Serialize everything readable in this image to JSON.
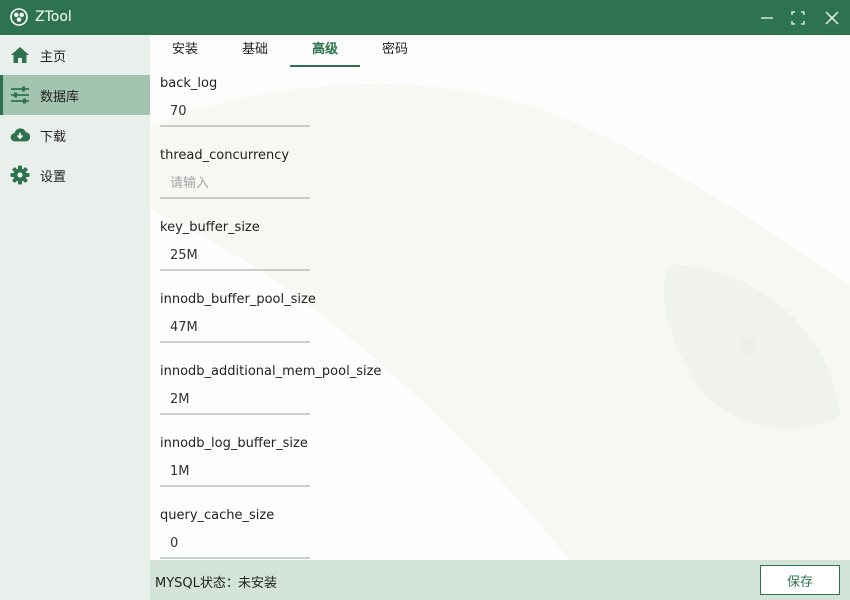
{
  "window": {
    "title": "ZTool",
    "logo_icon": "ztool-logo-icon",
    "controls": [
      "minimize-icon",
      "maximize-icon",
      "close-icon"
    ]
  },
  "sidebar": {
    "items": [
      {
        "label": "主页",
        "icon": "home-icon"
      },
      {
        "label": "数据库",
        "icon": "sliders-icon",
        "active": true
      },
      {
        "label": "下载",
        "icon": "cloud-download-icon"
      },
      {
        "label": "设置",
        "icon": "gear-icon"
      }
    ]
  },
  "tabs": [
    {
      "label": "安装"
    },
    {
      "label": "基础"
    },
    {
      "label": "高级",
      "active": true
    },
    {
      "label": "密码"
    }
  ],
  "fields": [
    {
      "label": "back_log",
      "value": "70",
      "placeholder": "请输入"
    },
    {
      "label": "thread_concurrency",
      "value": "",
      "placeholder": "请输入"
    },
    {
      "label": "key_buffer_size",
      "value": "25M",
      "placeholder": "请输入"
    },
    {
      "label": "innodb_buffer_pool_size",
      "value": "47M",
      "placeholder": "请输入"
    },
    {
      "label": "innodb_additional_mem_pool_size",
      "value": "2M",
      "placeholder": "请输入"
    },
    {
      "label": "innodb_log_buffer_size",
      "value": "1M",
      "placeholder": "请输入"
    },
    {
      "label": "query_cache_size",
      "value": "0",
      "placeholder": "请输入"
    }
  ],
  "status": {
    "label": "MYSQL状态：",
    "value": "未安装"
  },
  "save_button": {
    "label": "保存"
  },
  "colors": {
    "primary": "#2e7350",
    "sidebar_bg": "#e9efeb",
    "sidebar_active": "#a3c4ae",
    "statusbar_bg": "#d3e3d8"
  }
}
